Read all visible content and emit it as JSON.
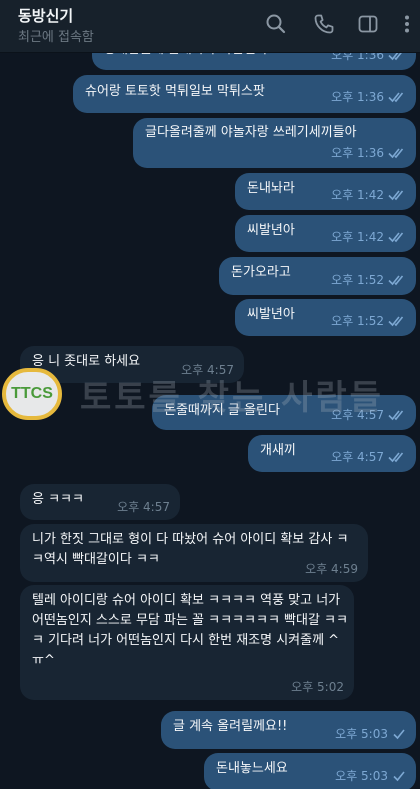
{
  "header": {
    "contact_name": "동방신기",
    "status": "최근에 접속함",
    "icons": [
      "search-icon",
      "phone-icon",
      "sidebar-toggle-icon",
      "more-icon"
    ]
  },
  "watermark": {
    "logo_text": "TTCS",
    "text": "토토를 찾는 사람들"
  },
  "messages": [
    {
      "id": "m0",
      "dir": "out",
      "text": "동개같을께 돈내놔라 사달년아",
      "time": "오후 1:36",
      "read": true
    },
    {
      "id": "m1",
      "dir": "out",
      "text": "슈어랑 토토핫 먹튀일보 막튀스팟",
      "time": "오후 1:36",
      "read": true
    },
    {
      "id": "m2",
      "dir": "out",
      "text": "글다올려줄께 야놀자랑 쓰레기세끼들아",
      "time": "오후 1:36",
      "read": true
    },
    {
      "id": "m3",
      "dir": "out",
      "text": "돈내놔라",
      "time": "오후 1:42",
      "read": true
    },
    {
      "id": "m4",
      "dir": "out",
      "text": "씨발년아",
      "time": "오후 1:42",
      "read": true
    },
    {
      "id": "m5",
      "dir": "out",
      "text": "돈가오라고",
      "time": "오후 1:52",
      "read": true
    },
    {
      "id": "m6",
      "dir": "out",
      "text": "씨발년아",
      "time": "오후 1:52",
      "read": true
    },
    {
      "id": "m7",
      "dir": "in",
      "text": "응 니 좃대로 하세요",
      "time": "오후 4:57"
    },
    {
      "id": "m8",
      "dir": "out",
      "text": "돈줄때까지 글 올린다",
      "time": "오후 4:57",
      "read": true
    },
    {
      "id": "m9",
      "dir": "out",
      "text": "개새끼",
      "time": "오후 4:57",
      "read": true
    },
    {
      "id": "m10",
      "dir": "in",
      "text": "응 ㅋㅋㅋ",
      "time": "오후 4:57"
    },
    {
      "id": "m11",
      "dir": "in",
      "text": "니가 한짓 그대로 형이 다 따놨어 슈어 아이디 확보 감사 ㅋㅋ역시 빡대갈이다 ㅋㅋ",
      "time": "오후 4:59"
    },
    {
      "id": "m12",
      "dir": "in",
      "text": "텔레 아이디랑 슈어 아이디 확보 ㅋㅋㅋㅋ 역풍 맞고 너가 어떤놈인지 스스로 무담 파는 꼴 ㅋㅋㅋㅋㅋㅋ 빡대갈 ㅋㅋㅋ 기다려 너가 어떤놈인지 다시 한번 재조명 시켜줄께 ^ㅠ^",
      "time": "오후 5:02"
    },
    {
      "id": "m13",
      "dir": "out",
      "text": "글 계속 올려릴께요!!",
      "time": "오후 5:03",
      "read": false
    },
    {
      "id": "m14",
      "dir": "out",
      "text": "돈내놓느세요",
      "time": "오후 5:03",
      "read": false
    }
  ]
}
